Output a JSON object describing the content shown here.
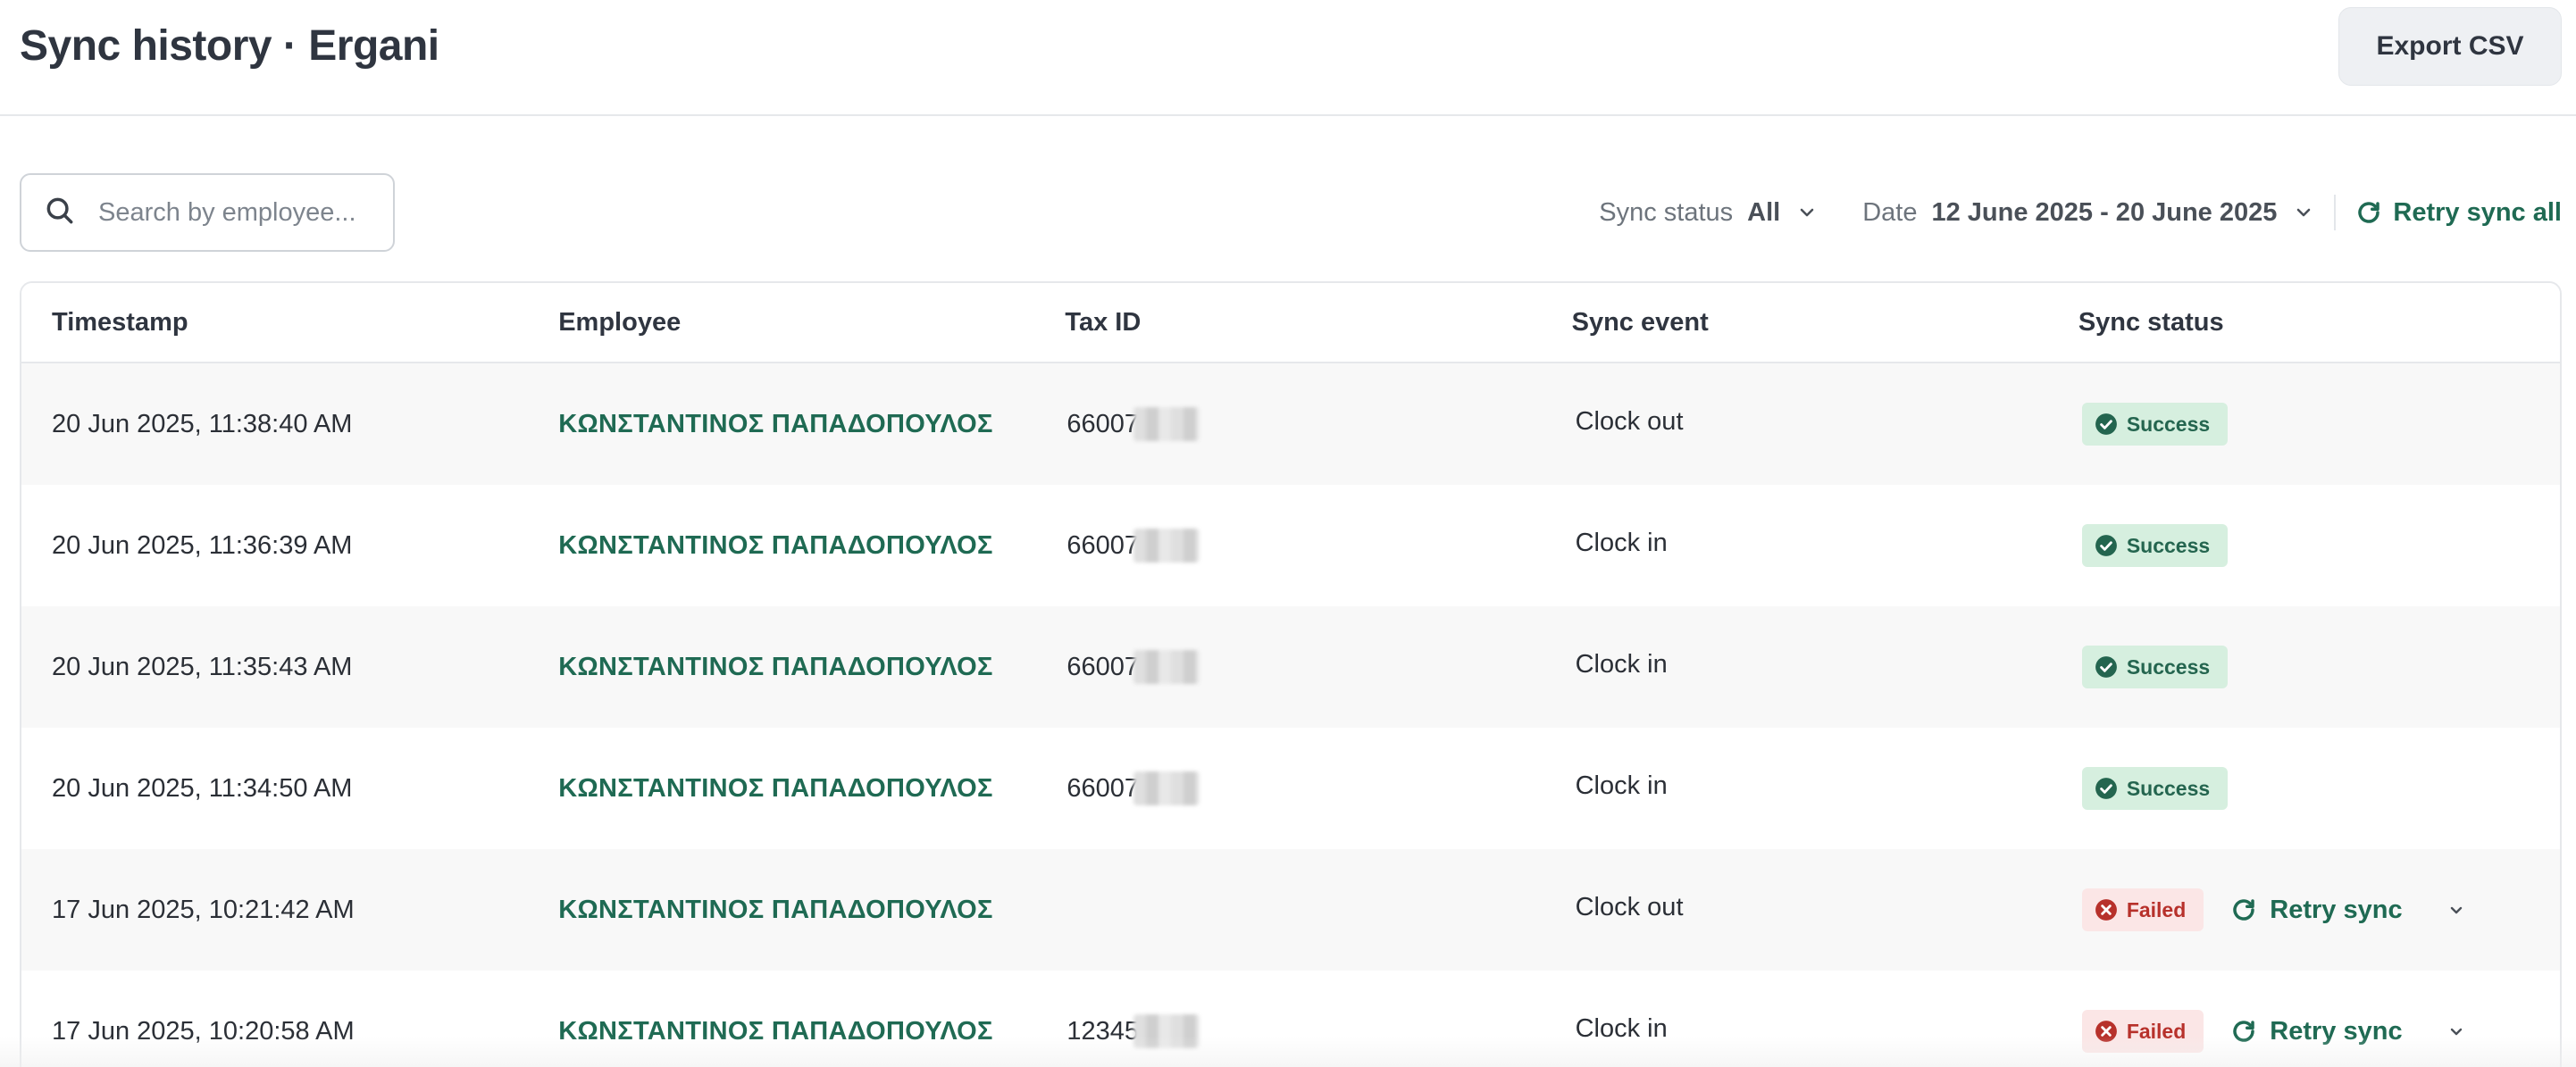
{
  "header": {
    "title": "Sync history · Ergani",
    "export_label": "Export CSV"
  },
  "toolbar": {
    "search_placeholder": "Search by employee...",
    "sync_status_label": "Sync status",
    "sync_status_value": "All",
    "date_label": "Date",
    "date_value": "12 June 2025 - 20 June 2025",
    "retry_all_label": "Retry sync all"
  },
  "table": {
    "columns": [
      "Timestamp",
      "Employee",
      "Tax ID",
      "Sync event",
      "Sync status"
    ],
    "rows": [
      {
        "timestamp": "20 Jun 2025, 11:38:40 AM",
        "employee": "ΚΩΝΣΤΑΝΤΙΝΟΣ ΠΑΠΑΔΟΠΟΥΛΟΣ",
        "tax_id": "66007",
        "event": "Clock out",
        "status": "Success"
      },
      {
        "timestamp": "20 Jun 2025, 11:36:39 AM",
        "employee": "ΚΩΝΣΤΑΝΤΙΝΟΣ ΠΑΠΑΔΟΠΟΥΛΟΣ",
        "tax_id": "66007",
        "event": "Clock in",
        "status": "Success"
      },
      {
        "timestamp": "20 Jun 2025, 11:35:43 AM",
        "employee": "ΚΩΝΣΤΑΝΤΙΝΟΣ ΠΑΠΑΔΟΠΟΥΛΟΣ",
        "tax_id": "66007",
        "event": "Clock in",
        "status": "Success"
      },
      {
        "timestamp": "20 Jun 2025, 11:34:50 AM",
        "employee": "ΚΩΝΣΤΑΝΤΙΝΟΣ ΠΑΠΑΔΟΠΟΥΛΟΣ",
        "tax_id": "66007",
        "event": "Clock in",
        "status": "Success"
      },
      {
        "timestamp": "17 Jun 2025, 10:21:42 AM",
        "employee": "ΚΩΝΣΤΑΝΤΙΝΟΣ ΠΑΠΑΔΟΠΟΥΛΟΣ",
        "tax_id": "",
        "event": "Clock out",
        "status": "Failed",
        "retry_label": "Retry sync"
      },
      {
        "timestamp": "17 Jun 2025, 10:20:58 AM",
        "employee": "ΚΩΝΣΤΑΝΤΙΝΟΣ ΠΑΠΑΔΟΠΟΥΛΟΣ",
        "tax_id": "12345",
        "event": "Clock in",
        "status": "Failed",
        "retry_label": "Retry sync"
      }
    ]
  },
  "colors": {
    "accent": "#1f6a53",
    "success_bg": "#d6efdf",
    "failed_bg": "#fbe6e6",
    "failed_text": "#b7312b"
  },
  "icons": [
    "search-icon",
    "chevron-down-icon",
    "refresh-icon",
    "check-circle-icon",
    "x-circle-icon"
  ]
}
